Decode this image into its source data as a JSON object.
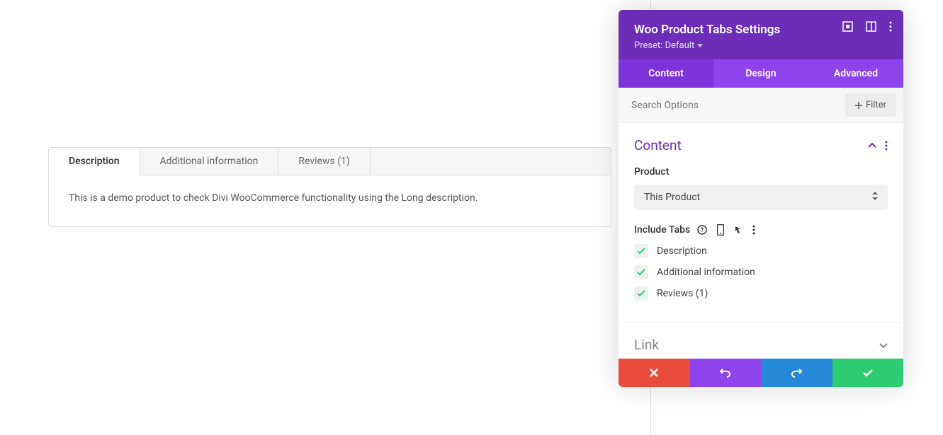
{
  "preview": {
    "tabs": [
      {
        "label": "Description",
        "active": true
      },
      {
        "label": "Additional information",
        "active": false
      },
      {
        "label": "Reviews (1)",
        "active": false
      }
    ],
    "content": "This is a demo product to check Divi WooCommerce functionality using the Long description."
  },
  "panel": {
    "title": "Woo Product Tabs Settings",
    "preset": "Preset: Default",
    "tabs": [
      {
        "label": "Content",
        "active": true
      },
      {
        "label": "Design",
        "active": false
      },
      {
        "label": "Advanced",
        "active": false
      }
    ],
    "search_placeholder": "Search Options",
    "filter_label": "Filter",
    "content_section": {
      "title": "Content",
      "product_label": "Product",
      "product_value": "This Product",
      "include_label": "Include Tabs",
      "include_items": [
        {
          "label": "Description",
          "checked": true
        },
        {
          "label": "Additional information",
          "checked": true
        },
        {
          "label": "Reviews (1)",
          "checked": true
        }
      ]
    },
    "link_section": {
      "title": "Link"
    }
  }
}
